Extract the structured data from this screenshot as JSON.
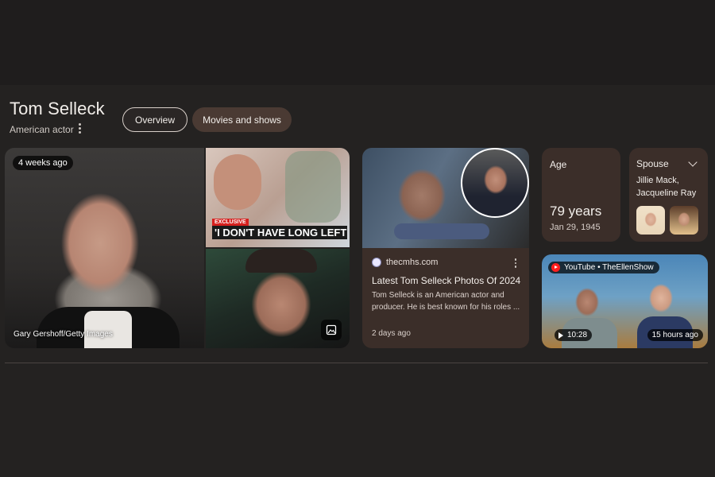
{
  "entity": {
    "title": "Tom Selleck",
    "subtitle": "American actor"
  },
  "tabs": [
    {
      "label": "Overview",
      "selected": true
    },
    {
      "label": "Movies and shows",
      "selected": false
    }
  ],
  "images": {
    "main_badge": "4 weeks ago",
    "main_credit": "Gary Gershoff/Getty Images",
    "top_right_tag": "EXCLUSIVE",
    "top_right_headline": "'I DON'T HAVE LONG LEFT"
  },
  "news": {
    "source": "thecmhs.com",
    "title": "Latest Tom Selleck Photos Of 2024",
    "snippet": "Tom Selleck is an American actor and producer. He is best known for his roles ...",
    "time": "2 days ago"
  },
  "age": {
    "label": "Age",
    "value": "79 years",
    "birth_date": "Jan 29, 1945"
  },
  "spouse": {
    "label": "Spouse",
    "names": "Jillie Mack, Jacqueline Ray"
  },
  "video": {
    "source": "YouTube • TheEllenShow",
    "duration": "10:28",
    "posted": "15 hours ago"
  },
  "icons": [
    "more-vert-icon",
    "gallery-icon",
    "chevron-down-icon",
    "youtube-icon",
    "play-icon",
    "site-favicon"
  ],
  "colors": {
    "background": "#211f1f",
    "card": "#3b2e29",
    "chip_selected_border": "#d8cfc9",
    "chip_unselected": "#4a3a33"
  }
}
